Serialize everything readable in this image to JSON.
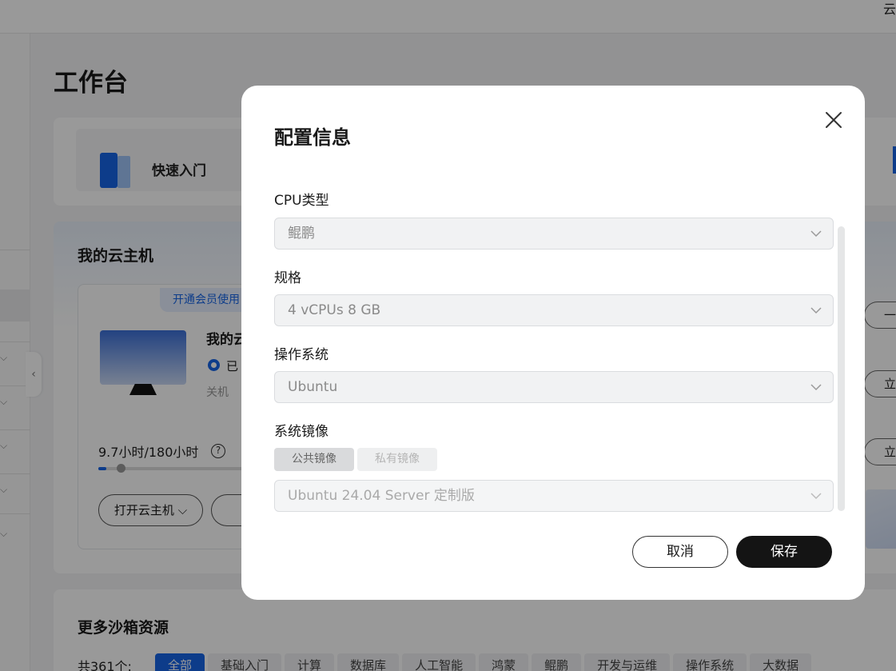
{
  "topbar": {
    "right_text": "云"
  },
  "page": {
    "title": "工作台"
  },
  "quick_entry": {
    "label": "快速入门"
  },
  "my_cloud": {
    "title": "我的云主机",
    "member_tag": "开通会员使用",
    "vm_name": "我的云",
    "vm_status": "已",
    "vm_power": "关机",
    "usage_text": "9.7小时/180小时",
    "usage_fraction": 0.054,
    "help_icon": "?",
    "open_button": "打开云主机 ⌵",
    "side_buttons": [
      "一",
      "立",
      "立"
    ]
  },
  "more": {
    "title": "更多沙箱资源",
    "count": "共361个:",
    "filters": [
      "全部",
      "基础入门",
      "计算",
      "数据库",
      "人工智能",
      "鸿蒙",
      "鲲鹏",
      "开发与运维",
      "操作系统",
      "大数据"
    ]
  },
  "modal": {
    "title": "配置信息",
    "cpu_label": "CPU类型",
    "cpu_value": "鲲鹏",
    "spec_label": "规格",
    "spec_value": "4 vCPUs 8 GB",
    "os_label": "操作系统",
    "os_value": "Ubuntu",
    "image_label": "系统镜像",
    "image_tabs": [
      "公共镜像",
      "私有镜像"
    ],
    "image_value": "Ubuntu 24.04 Server 定制版",
    "cancel": "取消",
    "save": "保存"
  },
  "colors": {
    "accent": "#1765e6",
    "primary_button": "#141414",
    "overlay": "rgba(0,0,0,0.40)"
  }
}
